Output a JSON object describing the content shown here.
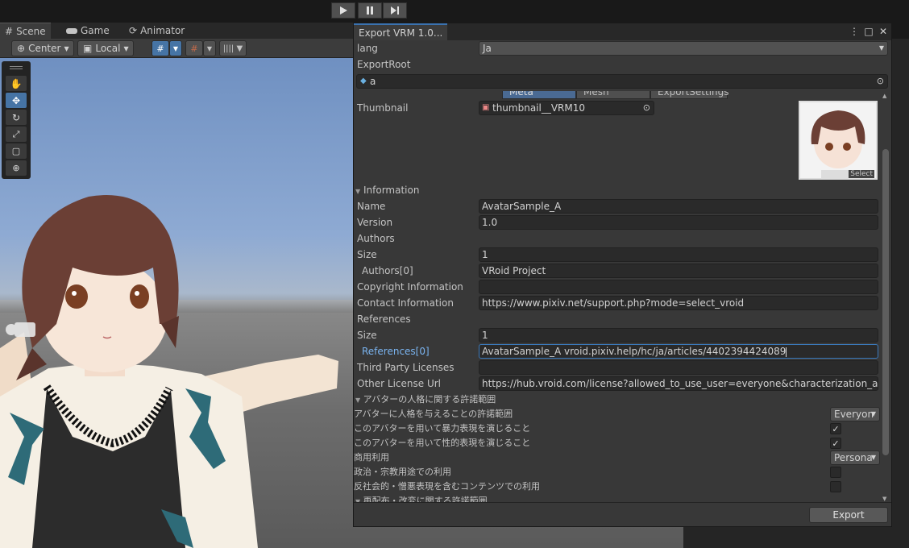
{
  "scene_tabs": [
    {
      "label": "Scene",
      "icon": "hash-icon"
    },
    {
      "label": "Game",
      "icon": "gamepad-icon"
    },
    {
      "label": "Animator",
      "icon": "animator-icon"
    }
  ],
  "scene_toolbar": {
    "pivot_label": "Center",
    "space_label": "Local"
  },
  "export_window": {
    "title": "Export VRM 1.0...",
    "lang_label": "lang",
    "lang_value": "Ja",
    "export_root_label": "ExportRoot",
    "export_root_value": "a",
    "tabs": [
      "Meta",
      "Mesh",
      "ExportSettings"
    ],
    "thumbnail_label": "Thumbnail",
    "thumbnail_value": "thumbnail__VRM10",
    "select_label": "Select",
    "information_label": "Information",
    "fields": {
      "name_label": "Name",
      "name_value": "AvatarSample_A",
      "version_label": "Version",
      "version_value": "1.0",
      "authors_label": "Authors",
      "authors_size_label": "Size",
      "authors_size_value": "1",
      "authors0_label": "Authors[0]",
      "authors0_value": "VRoid Project",
      "copyright_label": "Copyright Information",
      "copyright_value": "",
      "contact_label": "Contact Information",
      "contact_value": "https://www.pixiv.net/support.php?mode=select_vroid",
      "references_label": "References",
      "references_size_label": "Size",
      "references_size_value": "1",
      "references0_label": "References[0]",
      "references0_value": "AvatarSample_A vroid.pixiv.help/hc/ja/articles/4402394424089",
      "third_party_label": "Third Party Licenses",
      "third_party_value": "",
      "other_license_label": "Other License Url",
      "other_license_value": "https://hub.vroid.com/license?allowed_to_use_user=everyone&characterization_allowed"
    },
    "avatar_section_label": "アバターの人格に関する許諾範囲",
    "permissions": [
      {
        "label": "アバターに人格を与えることの許諾範囲",
        "kind": "dropdown",
        "value": "Everyon"
      },
      {
        "label": "このアバターを用いて暴力表現を演じること",
        "kind": "check",
        "checked": true
      },
      {
        "label": "このアバターを用いて性的表現を演じること",
        "kind": "check",
        "checked": true
      },
      {
        "label": "商用利用",
        "kind": "dropdown",
        "value": "Persona"
      },
      {
        "label": "政治・宗教用途での利用",
        "kind": "check",
        "checked": false
      },
      {
        "label": "反社会的・憎悪表現を含むコンテンツでの利用",
        "kind": "check",
        "checked": false
      }
    ],
    "redistribution_section_label": "再配布・改変に関する許諾範囲",
    "export_button": "Export"
  }
}
